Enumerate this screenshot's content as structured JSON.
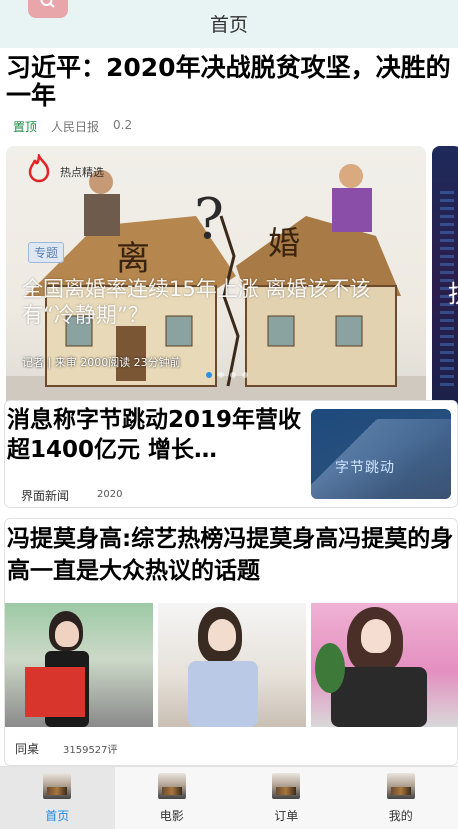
{
  "header": {
    "title": "首页",
    "search_icon": "search-icon",
    "accent": "#e8a6ab"
  },
  "top_story": {
    "title": "习近平：2020年决战脱贫攻坚，决胜的一年",
    "pin": "置顶",
    "source": "人民日报",
    "score": "0.2"
  },
  "carousel": {
    "hot_label": "热点精选",
    "tag": "专题",
    "title": "全国离婚率连续15年上涨 离婚该不该有“冷静期”？",
    "meta": "记者 | 来审  2000阅读  23分钟前",
    "art_words": [
      "离",
      "婚"
    ],
    "active_dot": 0,
    "dot_count": 4,
    "next_char": "抗"
  },
  "story2": {
    "title": "消息称字节跳动2019年营收超1400亿元 增长…",
    "source": "界面新闻",
    "year": "2020",
    "thumb_text": "字节跳动"
  },
  "story3": {
    "title": "冯提莫身高:综艺热榜冯提莫身高冯提莫的身高一直是大众热议的话题",
    "source": "同桌",
    "comments": "3159527评"
  },
  "bottom_nav": [
    {
      "label": "首页",
      "active": true
    },
    {
      "label": "电影",
      "active": false
    },
    {
      "label": "订单",
      "active": false
    },
    {
      "label": "我的",
      "active": false
    }
  ],
  "colors": {
    "nav_active": "#1e88e5",
    "pin": "#1a8c3e",
    "header_bg": "#e8f4f3"
  }
}
